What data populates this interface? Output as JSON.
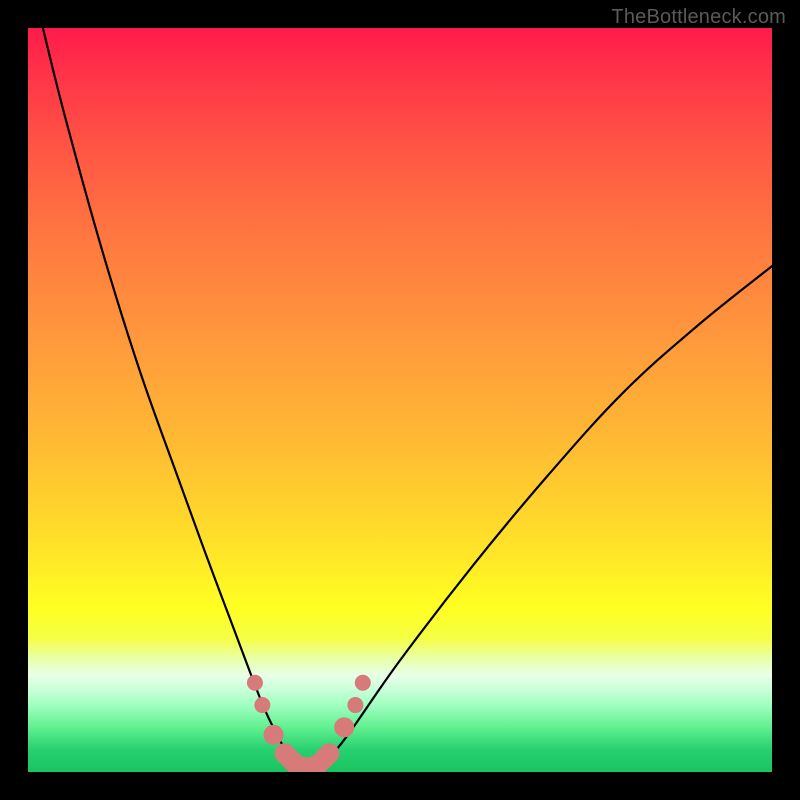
{
  "watermark": "TheBottleneck.com",
  "chart_data": {
    "type": "line",
    "title": "",
    "xlabel": "",
    "ylabel": "",
    "xlim": [
      0,
      100
    ],
    "ylim": [
      0,
      100
    ],
    "series": [
      {
        "name": "bottleneck-curve",
        "x": [
          2,
          5,
          10,
          15,
          20,
          24,
          27,
          30,
          32,
          34,
          35.5,
          37,
          38.5,
          40,
          43,
          50,
          60,
          70,
          80,
          90,
          100
        ],
        "y": [
          100,
          88,
          70,
          54,
          40,
          29,
          21,
          13,
          8,
          4,
          1.5,
          0.5,
          0.5,
          1.5,
          5,
          15,
          28,
          40,
          51,
          60,
          68
        ]
      }
    ],
    "markers": {
      "name": "recommended-range",
      "color": "#d67a7a",
      "points": [
        {
          "x": 30.5,
          "y": 12
        },
        {
          "x": 31.5,
          "y": 9
        },
        {
          "x": 33.0,
          "y": 5
        },
        {
          "x": 34.5,
          "y": 2.5
        },
        {
          "x": 36.0,
          "y": 1
        },
        {
          "x": 37.5,
          "y": 0.5
        },
        {
          "x": 39.0,
          "y": 1
        },
        {
          "x": 40.5,
          "y": 2.5
        },
        {
          "x": 42.5,
          "y": 6
        },
        {
          "x": 44.0,
          "y": 9
        },
        {
          "x": 45.0,
          "y": 12
        }
      ]
    },
    "background_gradient": {
      "top": "#ff1a4b",
      "mid": "#ffff22",
      "bottom": "#18c560"
    }
  }
}
